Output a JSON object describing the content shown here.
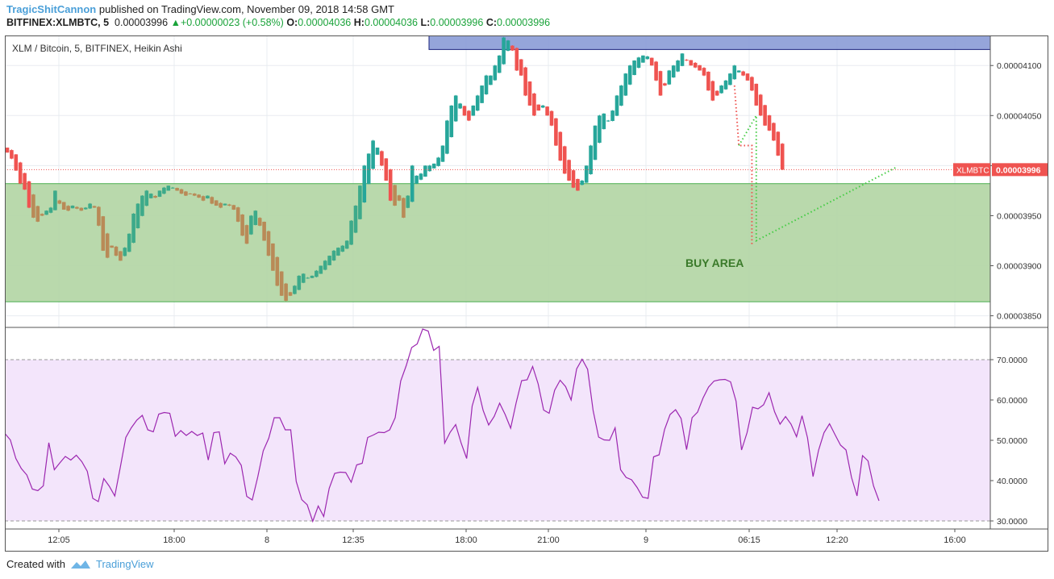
{
  "header": {
    "author": "TragicShitCannon",
    "published_text": "published on TradingView.com, November 09, 2018 14:58 GMT",
    "symbol": "BITFINEX:XLMBTC, 5",
    "last": "0.00003996",
    "change": "+0.00000023 (+0.58%)",
    "o_label": "O:",
    "o_val": "0.00004036",
    "h_label": "H:",
    "h_val": "0.00004036",
    "l_label": "L:",
    "l_val": "0.00003996",
    "c_label": "C:",
    "c_val": "0.00003996"
  },
  "legend": "XLM / Bitcoin, 5, BITFINEX, Heikin Ashi",
  "annotation": "BUY AREA",
  "price_tag": {
    "symbol": "XLMBTC",
    "value": "0.00003996"
  },
  "footer": {
    "created_with": "Created with",
    "brand": "TradingView"
  },
  "colors": {
    "up": "#26a69a",
    "down": "#ef5350",
    "zone_buy": "#b5d7a8",
    "zone_sell": "#8fa0d8",
    "rsi_line": "#9c27b0",
    "rsi_band": "#f3e5fb",
    "forecast": "#44cc44"
  },
  "chart_data": [
    {
      "type": "candlestick",
      "title": "XLM / Bitcoin, 5, BITFINEX, Heikin Ashi",
      "ylim": [
        3.84e-05,
        4.13e-05
      ],
      "y_ticks": [
        "0.00003850",
        "0.00003900",
        "0.00003950",
        "0.00004000",
        "0.00004050",
        "0.00004100"
      ],
      "x_ticks": [
        "12:05",
        "18:00",
        "8",
        "12:35",
        "18:00",
        "21:00",
        "9",
        "06:15",
        "12:20",
        "16:00"
      ],
      "last_price": 3.996e-05,
      "zones": [
        {
          "label": "BUY AREA",
          "from": 3.864e-05,
          "to": 3.982e-05
        },
        {
          "label": "",
          "from": 4.116e-05,
          "to": 4.136e-05
        }
      ],
      "close_series": [
        4013,
        4007,
        3995,
        3982,
        3976,
        3958,
        3948,
        3944,
        3950,
        3955,
        3958,
        3975,
        3962,
        3956,
        3955,
        3960,
        3957,
        3955,
        3958,
        3962,
        3958,
        3940,
        3915,
        3908,
        3918,
        3910,
        3905,
        3918,
        3932,
        3952,
        3962,
        3970,
        3975,
        3972,
        3968,
        3975,
        3978,
        3980,
        3978,
        3975,
        3972,
        3970,
        3972,
        3970,
        3968,
        3965,
        3970,
        3962,
        3960,
        3958,
        3962,
        3960,
        3956,
        3944,
        3930,
        3922,
        3950,
        3955,
        3940,
        3925,
        3910,
        3895,
        3880,
        3870,
        3865,
        3870,
        3880,
        3890,
        3892,
        3888,
        3890,
        3895,
        3900,
        3905,
        3910,
        3915,
        3918,
        3920,
        3925,
        3945,
        3960,
        3980,
        4000,
        4012,
        4025,
        4018,
        4000,
        3985,
        3965,
        3960,
        3965,
        3948,
        3970,
        4000,
        3990,
        3992,
        4000,
        4000,
        4002,
        4008,
        4020,
        4045,
        4060,
        4070,
        4062,
        4050,
        4045,
        4060,
        4070,
        4080,
        4090,
        4090,
        4100,
        4110,
        4128,
        4125,
        4115,
        4095,
        4090,
        4070,
        4060,
        4050,
        4055,
        4060,
        4050,
        4040,
        4020,
        4005,
        3992,
        3985,
        3978,
        3975,
        3985,
        4000,
        4020,
        4040,
        4050,
        4052,
        4045,
        4055,
        4070,
        4080,
        4092,
        4100,
        4105,
        4108,
        4110,
        4109,
        4100,
        4085,
        4070,
        4080,
        4095,
        4100,
        4105,
        4112,
        4105,
        4100,
        4098,
        4095,
        4090,
        4075,
        4065,
        4070,
        4080,
        4085,
        4092,
        4100,
        4095,
        4090,
        4085,
        4075,
        4060,
        4050,
        4040,
        4035,
        4025,
        4010,
        3996
      ],
      "series": [
        {
          "name": "",
          "style": "dotted-red",
          "points": [
            {
              "i": 167,
              "y": 4.08e-05
            },
            {
              "i": 168,
              "y": 4.02e-05
            },
            {
              "i": 171,
              "y": 4.02e-05
            },
            {
              "i": 171,
              "y": 3.92e-05
            }
          ]
        },
        {
          "name": "",
          "style": "dotted-green",
          "points": [
            {
              "i": 168,
              "y": 4.02e-05
            },
            {
              "i": 172,
              "y": 4.05e-05
            },
            {
              "i": 172,
              "y": 3.925e-05
            },
            {
              "i": 204,
              "y": 3.998e-05
            }
          ]
        }
      ]
    },
    {
      "type": "line",
      "title": "",
      "ylim": [
        28,
        78
      ],
      "y_ticks": [
        "30.0000",
        "40.0000",
        "50.0000",
        "60.0000",
        "70.0000"
      ],
      "band": [
        30,
        70
      ],
      "series": [
        {
          "name": "",
          "values": [
            51.7,
            50.1,
            45.5,
            43.0,
            41.4,
            37.9,
            37.5,
            38.7,
            49.4,
            42.7,
            44.4,
            46.0,
            45.1,
            46.3,
            44.7,
            42.3,
            35.6,
            34.8,
            40.5,
            38.6,
            36.2,
            43.3,
            50.7,
            53.1,
            55.0,
            56.2,
            52.6,
            52.1,
            56.5,
            56.9,
            56.7,
            51.0,
            52.4,
            51.2,
            52.2,
            51.2,
            51.8,
            45.1,
            51.9,
            52.1,
            44.2,
            46.8,
            45.9,
            43.8,
            36.1,
            35.2,
            40.9,
            47.4,
            50.5,
            55.6,
            55.6,
            52.6,
            52.6,
            39.8,
            35.3,
            34.0,
            29.9,
            33.7,
            31.1,
            38.1,
            41.8,
            42.1,
            42.0,
            39.6,
            43.9,
            44.3,
            50.7,
            51.3,
            52.0,
            51.9,
            52.6,
            55.6,
            64.7,
            68.5,
            73.0,
            73.9,
            77.6,
            77.1,
            72.3,
            73.3,
            49.3,
            52.0,
            53.9,
            49.3,
            45.5,
            58.5,
            63.1,
            57.4,
            53.8,
            55.9,
            59.2,
            56.4,
            53.0,
            59.3,
            64.8,
            65.0,
            68.3,
            64.0,
            57.5,
            56.7,
            62.4,
            64.9,
            63.3,
            60.0,
            67.7,
            70.1,
            67.6,
            57.4,
            50.8,
            50.1,
            50.0,
            53.1,
            42.7,
            40.8,
            40.2,
            38.3,
            35.9,
            35.6,
            45.9,
            46.4,
            52.7,
            56.4,
            57.6,
            55.4,
            47.7,
            55.6,
            57.0,
            60.5,
            63.2,
            64.7,
            65.0,
            65.1,
            64.5,
            59.7,
            47.6,
            51.9,
            58.2,
            57.8,
            58.8,
            61.8,
            57.1,
            54.0,
            55.9,
            54.0,
            50.9,
            56.1,
            50.6,
            41.0,
            47.5,
            51.9,
            54.1,
            51.4,
            48.8,
            47.6,
            40.8,
            36.2,
            46.2,
            44.9,
            38.7,
            35.0
          ]
        }
      ]
    }
  ]
}
